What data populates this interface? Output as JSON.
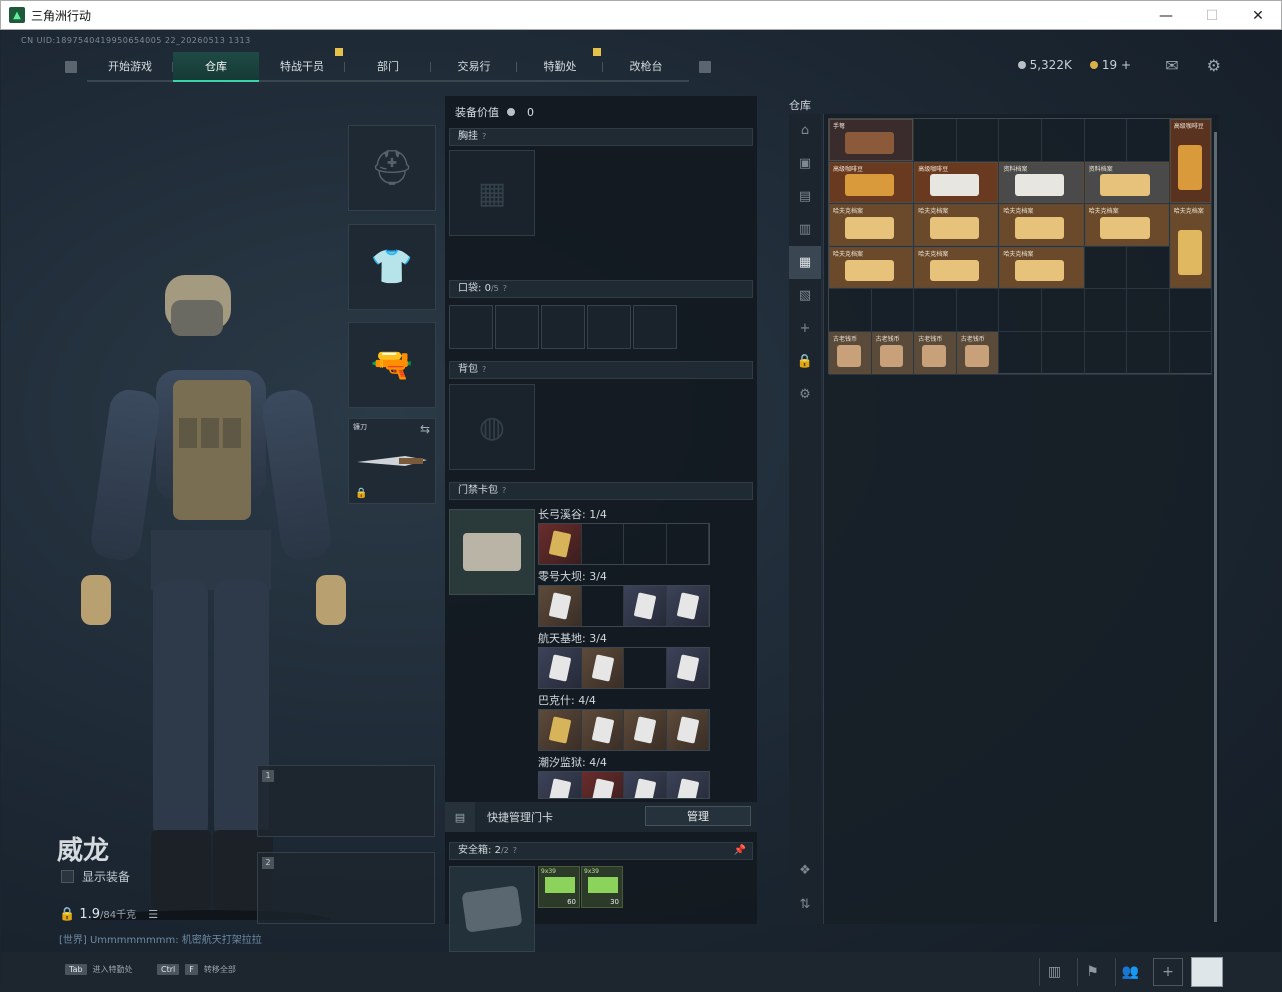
{
  "window": {
    "title": "三角洲行动",
    "minimize": "—",
    "maximize": "☐",
    "close": "✕"
  },
  "uid": "CN UID:1897540419950654005 22_20260513 1313",
  "nav": {
    "tabs": [
      {
        "label": "开始游戏",
        "active": false
      },
      {
        "label": "仓库",
        "active": true
      },
      {
        "label": "特战干员",
        "active": false
      },
      {
        "label": "部门",
        "active": false
      },
      {
        "label": "交易行",
        "active": false
      },
      {
        "label": "特勤处",
        "active": false
      },
      {
        "label": "改枪台",
        "active": false
      }
    ],
    "currency_silver": "5,322K",
    "currency_gold": "19",
    "gold_plus": "+"
  },
  "operator": {
    "name": "威龙",
    "show_gear_label": "显示装备",
    "weight_value": "1.9",
    "weight_max": "/84千克",
    "chat_text": "[世界] Ummmmmmmm: 机密航天打架拉拉"
  },
  "slots": {
    "melee_tag": "镰刀",
    "weapon1_num": "1",
    "weapon2_num": "2"
  },
  "loadout": {
    "value_label": "装备价值",
    "value": "0",
    "chest_rig": "胸挂",
    "pocket_label": "口袋:",
    "pocket_value": "0",
    "pocket_max": "/5",
    "backpack": "背包",
    "keycard_bag": "门禁卡包",
    "maps": [
      {
        "label": "长弓溪谷: 1/4"
      },
      {
        "label": "零号大坝: 3/4"
      },
      {
        "label": "航天基地: 3/4"
      },
      {
        "label": "巴克什: 4/4"
      },
      {
        "label": "潮汐监狱: 4/4"
      }
    ],
    "quick_manage": "快捷管理门卡",
    "manage_button": "管理",
    "safe_label": "安全箱:",
    "safe_value": "2",
    "safe_max": "/2",
    "ammo": [
      {
        "tag": "9x39",
        "count": "60"
      },
      {
        "tag": "9x39",
        "count": "30"
      }
    ]
  },
  "warehouse": {
    "title": "仓库",
    "items": [
      {
        "label": "手弩",
        "color": "#3a2c2c"
      },
      {
        "label": "高级咖啡豆",
        "color": "#5a3320"
      },
      {
        "label": "高级咖啡豆",
        "color": "#6a3a20"
      },
      {
        "label": "高级咖啡豆",
        "color": "#6a3a20"
      },
      {
        "label": "资料档案",
        "color": "#4a4a4a"
      },
      {
        "label": "资料档案",
        "color": "#4a4a4a"
      },
      {
        "label": "哈夫克档案",
        "color": "#6a4a2a"
      },
      {
        "label": "哈夫克档案",
        "color": "#6a4a2a"
      },
      {
        "label": "哈夫克档案",
        "color": "#6a4a2a"
      },
      {
        "label": "哈夫克档案",
        "color": "#6a4a2a"
      },
      {
        "label": "哈夫克档案",
        "color": "#6a4a2a"
      },
      {
        "label": "哈夫克档案",
        "color": "#6a4a2a"
      },
      {
        "label": "哈夫克档案",
        "color": "#6a4a2a"
      },
      {
        "label": "哈夫克档案",
        "color": "#6a4a2a"
      },
      {
        "label": "哈夫克档案",
        "color": "#6a4a2a"
      },
      {
        "label": "古老钱币",
        "color": "#5a4a3a"
      },
      {
        "label": "古老钱币",
        "color": "#5a4a3a"
      },
      {
        "label": "古老钱币",
        "color": "#5a4a3a"
      },
      {
        "label": "古老钱币",
        "color": "#5a4a3a"
      }
    ]
  },
  "bottom": {
    "hint1_key": "Tab",
    "hint1_text": "进入特勤处",
    "hint2_key1": "Ctrl",
    "hint2_key2": "F",
    "hint2_text": "转移全部"
  }
}
